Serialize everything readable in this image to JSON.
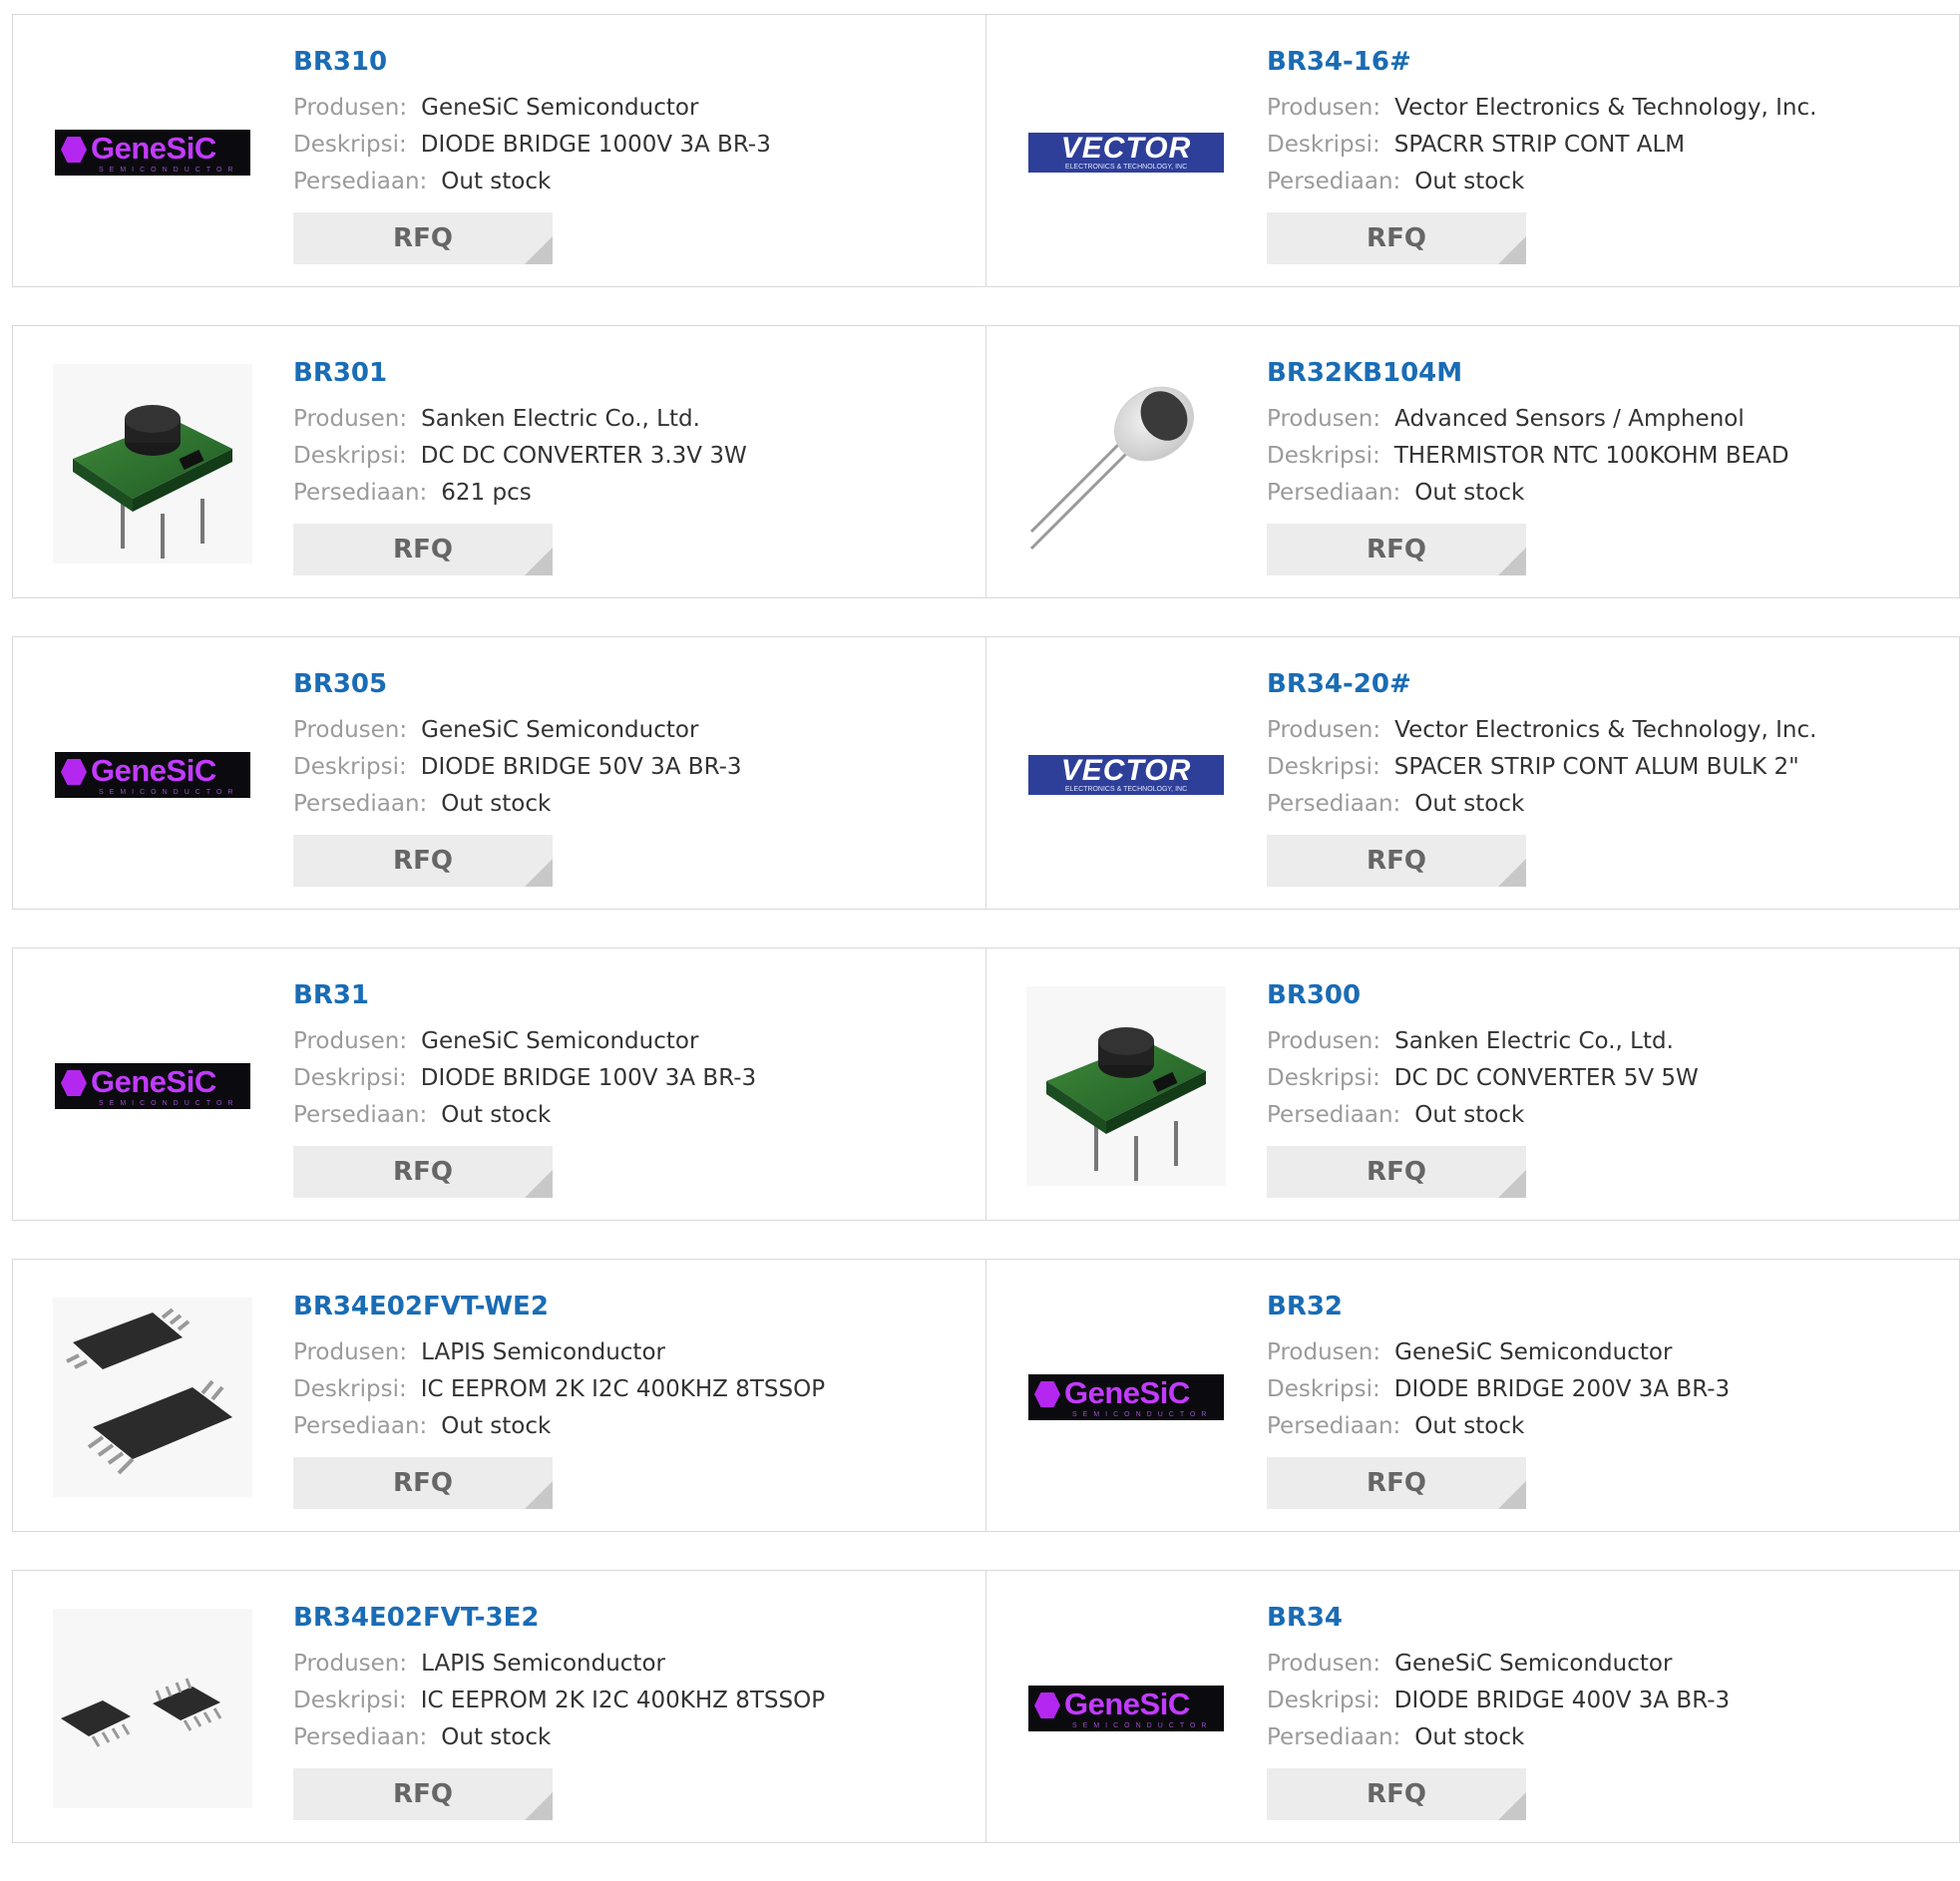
{
  "labels": {
    "manufacturer": "Produsen:",
    "description": "Deskripsi:",
    "stock": "Persediaan:",
    "rfq": "RFQ"
  },
  "logos": {
    "genesic": {
      "word": "GeneSiC",
      "sub": "SEMICONDUCTOR"
    },
    "vector": {
      "word": "VECTOR",
      "sub": "ELECTRONICS & TECHNOLOGY, INC"
    }
  },
  "products": [
    {
      "part": "BR310",
      "manufacturer": "GeneSiC Semiconductor",
      "description": "DIODE BRIDGE 1000V 3A BR-3",
      "stock": "Out stock",
      "image": "genesic-logo"
    },
    {
      "part": "BR34-16#",
      "manufacturer": "Vector Electronics & Technology, Inc.",
      "description": "SPACRR STRIP CONT ALM",
      "stock": "Out stock",
      "image": "vector-logo"
    },
    {
      "part": "BR301",
      "manufacturer": "Sanken Electric Co., Ltd.",
      "description": "DC DC CONVERTER 3.3V 3W",
      "stock": "621 pcs",
      "image": "dc-converter-module"
    },
    {
      "part": "BR32KB104M",
      "manufacturer": "Advanced Sensors / Amphenol",
      "description": "THERMISTOR NTC 100KOHM BEAD",
      "stock": "Out stock",
      "image": "thermistor-bead"
    },
    {
      "part": "BR305",
      "manufacturer": "GeneSiC Semiconductor",
      "description": "DIODE BRIDGE 50V 3A BR-3",
      "stock": "Out stock",
      "image": "genesic-logo"
    },
    {
      "part": "BR34-20#",
      "manufacturer": "Vector Electronics & Technology, Inc.",
      "description": "SPACER STRIP CONT ALUM BULK 2\"",
      "stock": "Out stock",
      "image": "vector-logo"
    },
    {
      "part": "BR31",
      "manufacturer": "GeneSiC Semiconductor",
      "description": "DIODE BRIDGE 100V 3A BR-3",
      "stock": "Out stock",
      "image": "genesic-logo"
    },
    {
      "part": "BR300",
      "manufacturer": "Sanken Electric Co., Ltd.",
      "description": "DC DC CONVERTER 5V 5W",
      "stock": "Out stock",
      "image": "dc-converter-module"
    },
    {
      "part": "BR34E02FVT-WE2",
      "manufacturer": "LAPIS Semiconductor",
      "description": "IC EEPROM 2K I2C 400KHZ 8TSSOP",
      "stock": "Out stock",
      "image": "tssop-chip-pair"
    },
    {
      "part": "BR32",
      "manufacturer": "GeneSiC Semiconductor",
      "description": "DIODE BRIDGE 200V 3A BR-3",
      "stock": "Out stock",
      "image": "genesic-logo"
    },
    {
      "part": "BR34E02FVT-3E2",
      "manufacturer": "LAPIS Semiconductor",
      "description": "IC EEPROM 2K I2C 400KHZ 8TSSOP",
      "stock": "Out stock",
      "image": "tssop-chip-pair-small"
    },
    {
      "part": "BR34",
      "manufacturer": "GeneSiC Semiconductor",
      "description": "DIODE BRIDGE 400V 3A BR-3",
      "stock": "Out stock",
      "image": "genesic-logo"
    }
  ]
}
